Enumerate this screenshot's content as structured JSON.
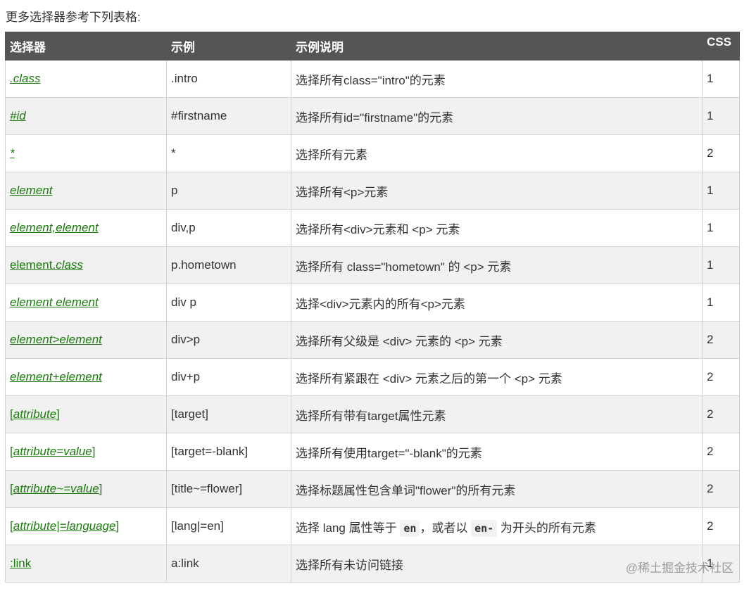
{
  "intro_text": "更多选择器参考下列表格:",
  "headers": [
    "选择器",
    "示例",
    "示例说明",
    "CSS"
  ],
  "rows": [
    {
      "example": "[attribute]",
      "css": "2"
    }
  ],
  "selectors": {
    "r0": {
      "p0": ".class"
    },
    "r1": {
      "p0": "#id"
    },
    "r2": {
      "p0": "*"
    },
    "r3": {
      "p0": "element"
    },
    "r4": {
      "p0": "element,element"
    },
    "r5": {
      "p0": "element.",
      "p1": "class"
    },
    "r6": {
      "p0": "element element"
    },
    "r7": {
      "p0": "element>element"
    },
    "r8": {
      "p0": "element+element"
    },
    "r9": {
      "p0": "[",
      "p1": "attribute",
      "p2": "]"
    },
    "r10": {
      "p0": "[",
      "p1": "attribute=value",
      "p2": "]"
    },
    "r11": {
      "p0": "[",
      "p1": "attribute~=value",
      "p2": "]"
    },
    "r12": {
      "p0": "[",
      "p1": "attribute|=language",
      "p2": "]"
    },
    "r13": {
      "p0": ":link"
    }
  },
  "examples": [
    ".intro",
    "#firstname",
    "*",
    "p",
    "div,p",
    "p.hometown",
    "div p",
    "div>p",
    "div+p",
    "[target]",
    "[target=-blank]",
    "[title~=flower]",
    "[lang|=en]",
    "a:link"
  ],
  "descriptions": [
    "选择所有class=\"intro\"的元素",
    "选择所有id=\"firstname\"的元素",
    "选择所有元素",
    "选择所有<p>元素",
    "选择所有<div>元素和 <p> 元素",
    "选择所有 class=\"hometown\" 的 <p> 元素",
    "选择<div>元素内的所有<p>元素",
    "选择所有父级是 <div> 元素的 <p> 元素",
    "选择所有紧跟在 <div> 元素之后的第一个 <p> 元素",
    "选择所有带有target属性元素",
    "选择所有使用target=\"-blank\"的元素",
    "选择标题属性包含单词\"flower\"的所有元素",
    null,
    "选择所有未访问链接"
  ],
  "desc_rich": {
    "t1": "选择 lang 属性等于 ",
    "c1": "en",
    "t2": "，或者以 ",
    "c2": "en-",
    "t3": " 为开头的所有元素"
  },
  "css": [
    "1",
    "1",
    "2",
    "1",
    "1",
    "1",
    "1",
    "2",
    "2",
    "2",
    "2",
    "2",
    "2",
    "1"
  ],
  "watermark": "@稀土掘金技术社区"
}
